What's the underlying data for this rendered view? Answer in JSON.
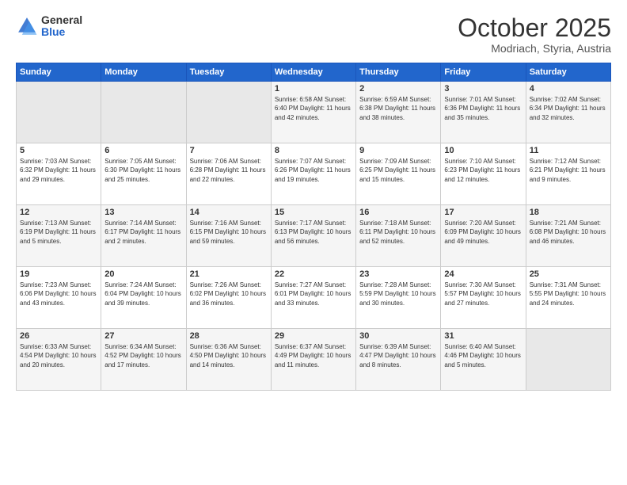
{
  "logo": {
    "general": "General",
    "blue": "Blue"
  },
  "header": {
    "month": "October 2025",
    "location": "Modriach, Styria, Austria"
  },
  "weekdays": [
    "Sunday",
    "Monday",
    "Tuesday",
    "Wednesday",
    "Thursday",
    "Friday",
    "Saturday"
  ],
  "weeks": [
    [
      {
        "day": "",
        "info": ""
      },
      {
        "day": "",
        "info": ""
      },
      {
        "day": "",
        "info": ""
      },
      {
        "day": "1",
        "info": "Sunrise: 6:58 AM\nSunset: 6:40 PM\nDaylight: 11 hours\nand 42 minutes."
      },
      {
        "day": "2",
        "info": "Sunrise: 6:59 AM\nSunset: 6:38 PM\nDaylight: 11 hours\nand 38 minutes."
      },
      {
        "day": "3",
        "info": "Sunrise: 7:01 AM\nSunset: 6:36 PM\nDaylight: 11 hours\nand 35 minutes."
      },
      {
        "day": "4",
        "info": "Sunrise: 7:02 AM\nSunset: 6:34 PM\nDaylight: 11 hours\nand 32 minutes."
      }
    ],
    [
      {
        "day": "5",
        "info": "Sunrise: 7:03 AM\nSunset: 6:32 PM\nDaylight: 11 hours\nand 29 minutes."
      },
      {
        "day": "6",
        "info": "Sunrise: 7:05 AM\nSunset: 6:30 PM\nDaylight: 11 hours\nand 25 minutes."
      },
      {
        "day": "7",
        "info": "Sunrise: 7:06 AM\nSunset: 6:28 PM\nDaylight: 11 hours\nand 22 minutes."
      },
      {
        "day": "8",
        "info": "Sunrise: 7:07 AM\nSunset: 6:26 PM\nDaylight: 11 hours\nand 19 minutes."
      },
      {
        "day": "9",
        "info": "Sunrise: 7:09 AM\nSunset: 6:25 PM\nDaylight: 11 hours\nand 15 minutes."
      },
      {
        "day": "10",
        "info": "Sunrise: 7:10 AM\nSunset: 6:23 PM\nDaylight: 11 hours\nand 12 minutes."
      },
      {
        "day": "11",
        "info": "Sunrise: 7:12 AM\nSunset: 6:21 PM\nDaylight: 11 hours\nand 9 minutes."
      }
    ],
    [
      {
        "day": "12",
        "info": "Sunrise: 7:13 AM\nSunset: 6:19 PM\nDaylight: 11 hours\nand 5 minutes."
      },
      {
        "day": "13",
        "info": "Sunrise: 7:14 AM\nSunset: 6:17 PM\nDaylight: 11 hours\nand 2 minutes."
      },
      {
        "day": "14",
        "info": "Sunrise: 7:16 AM\nSunset: 6:15 PM\nDaylight: 10 hours\nand 59 minutes."
      },
      {
        "day": "15",
        "info": "Sunrise: 7:17 AM\nSunset: 6:13 PM\nDaylight: 10 hours\nand 56 minutes."
      },
      {
        "day": "16",
        "info": "Sunrise: 7:18 AM\nSunset: 6:11 PM\nDaylight: 10 hours\nand 52 minutes."
      },
      {
        "day": "17",
        "info": "Sunrise: 7:20 AM\nSunset: 6:09 PM\nDaylight: 10 hours\nand 49 minutes."
      },
      {
        "day": "18",
        "info": "Sunrise: 7:21 AM\nSunset: 6:08 PM\nDaylight: 10 hours\nand 46 minutes."
      }
    ],
    [
      {
        "day": "19",
        "info": "Sunrise: 7:23 AM\nSunset: 6:06 PM\nDaylight: 10 hours\nand 43 minutes."
      },
      {
        "day": "20",
        "info": "Sunrise: 7:24 AM\nSunset: 6:04 PM\nDaylight: 10 hours\nand 39 minutes."
      },
      {
        "day": "21",
        "info": "Sunrise: 7:26 AM\nSunset: 6:02 PM\nDaylight: 10 hours\nand 36 minutes."
      },
      {
        "day": "22",
        "info": "Sunrise: 7:27 AM\nSunset: 6:01 PM\nDaylight: 10 hours\nand 33 minutes."
      },
      {
        "day": "23",
        "info": "Sunrise: 7:28 AM\nSunset: 5:59 PM\nDaylight: 10 hours\nand 30 minutes."
      },
      {
        "day": "24",
        "info": "Sunrise: 7:30 AM\nSunset: 5:57 PM\nDaylight: 10 hours\nand 27 minutes."
      },
      {
        "day": "25",
        "info": "Sunrise: 7:31 AM\nSunset: 5:55 PM\nDaylight: 10 hours\nand 24 minutes."
      }
    ],
    [
      {
        "day": "26",
        "info": "Sunrise: 6:33 AM\nSunset: 4:54 PM\nDaylight: 10 hours\nand 20 minutes."
      },
      {
        "day": "27",
        "info": "Sunrise: 6:34 AM\nSunset: 4:52 PM\nDaylight: 10 hours\nand 17 minutes."
      },
      {
        "day": "28",
        "info": "Sunrise: 6:36 AM\nSunset: 4:50 PM\nDaylight: 10 hours\nand 14 minutes."
      },
      {
        "day": "29",
        "info": "Sunrise: 6:37 AM\nSunset: 4:49 PM\nDaylight: 10 hours\nand 11 minutes."
      },
      {
        "day": "30",
        "info": "Sunrise: 6:39 AM\nSunset: 4:47 PM\nDaylight: 10 hours\nand 8 minutes."
      },
      {
        "day": "31",
        "info": "Sunrise: 6:40 AM\nSunset: 4:46 PM\nDaylight: 10 hours\nand 5 minutes."
      },
      {
        "day": "",
        "info": ""
      }
    ]
  ]
}
